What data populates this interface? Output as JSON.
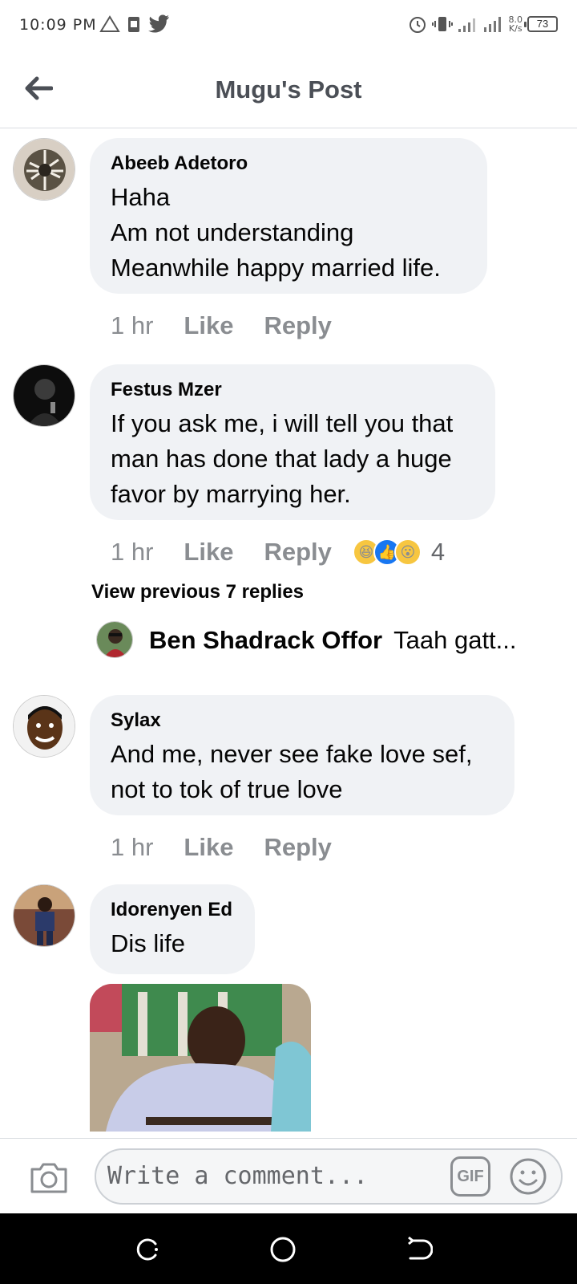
{
  "status_bar": {
    "time": "10:09 PM",
    "net_speed_value": "8.0",
    "net_speed_unit": "K/s",
    "battery": "73"
  },
  "header": {
    "title": "Mugu's Post"
  },
  "comments": [
    {
      "author": "Abeeb Adetoro",
      "lines": [
        "Haha",
        "Am not understanding",
        "Meanwhile happy married life."
      ],
      "time": "1 hr",
      "like": "Like",
      "reply": "Reply"
    },
    {
      "author": "Festus Mzer",
      "lines": [
        "If you ask me, i will tell you that",
        "man has done that lady a huge",
        "favor by marrying her."
      ],
      "time": "1 hr",
      "like": "Like",
      "reply": "Reply",
      "reaction_count": "4",
      "reactions": [
        "haha-emoji",
        "like-emoji",
        "wow-emoji"
      ]
    },
    {
      "author": "Sylax",
      "lines": [
        "And me, never see fake love sef,",
        "not to tok of true love"
      ],
      "time": "1 hr",
      "like": "Like",
      "reply": "Reply"
    },
    {
      "author": "Idorenyen Ed",
      "lines": [
        "Dis life"
      ]
    }
  ],
  "replies": {
    "view_previous": "View previous 7 replies",
    "preview_author": "Ben Shadrack Offor",
    "preview_text": "Taah gatt..."
  },
  "composer": {
    "placeholder": "Write a comment...",
    "gif_label": "GIF"
  },
  "colors": {
    "bubble": "#f0f2f5",
    "meta_text": "#8a8d91",
    "header_text": "#4b4f56",
    "navbar": "#000000"
  }
}
